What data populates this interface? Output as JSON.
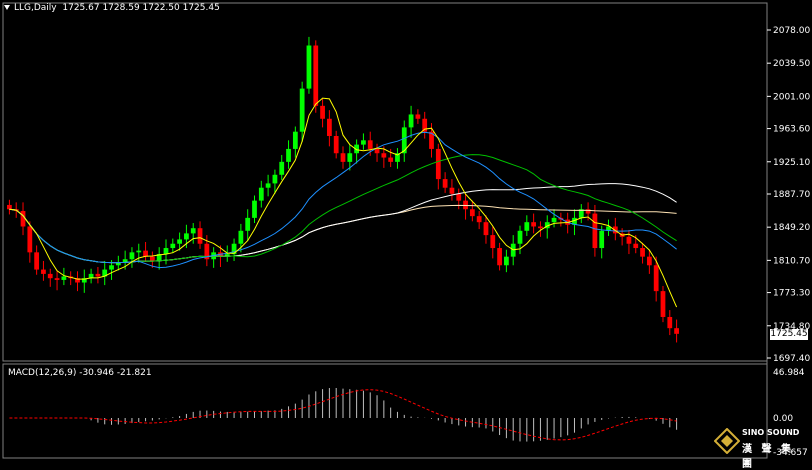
{
  "header": {
    "symbol_timeframe": "LLG,Daily",
    "ohlc": "1725.67 1728.59 1722.50 1725.45"
  },
  "price_axis": {
    "ticks": [
      "2078.00",
      "2039.50",
      "2001.00",
      "1963.60",
      "1925.10",
      "1887.70",
      "1849.20",
      "1810.70",
      "1773.30",
      "1734.80",
      "1697.40"
    ],
    "current_price": "1725.45"
  },
  "macd": {
    "label": "MACD(12,26,9) -30.946 -21.821",
    "ticks": [
      "46.984",
      "0.00",
      "-34.657"
    ]
  },
  "watermark": {
    "brand_en": "SINO SOUND",
    "brand_cn": "漢 聲 集 團"
  },
  "colors": {
    "bull": "#00ff00",
    "bear": "#ff0000",
    "ma_fast": "#ffff00",
    "ma_mid": "#1e90ff",
    "ma_slow": "#00c000",
    "ma_long": "#ffffff",
    "ma_longest": "#ffe4b5"
  },
  "chart_data": {
    "type": "candlestick",
    "ylim": [
      1697.4,
      2078.0
    ],
    "close_series": [
      1870,
      1868,
      1850,
      1820,
      1800,
      1795,
      1790,
      1788,
      1792,
      1790,
      1785,
      1790,
      1795,
      1792,
      1800,
      1805,
      1808,
      1812,
      1820,
      1822,
      1815,
      1810,
      1818,
      1825,
      1830,
      1835,
      1842,
      1848,
      1830,
      1812,
      1820,
      1815,
      1818,
      1830,
      1845,
      1860,
      1880,
      1895,
      1900,
      1910,
      1925,
      1940,
      1960,
      2010,
      2060,
      1990,
      1975,
      1955,
      1935,
      1925,
      1935,
      1945,
      1950,
      1940,
      1935,
      1930,
      1925,
      1935,
      1965,
      1980,
      1975,
      1960,
      1940,
      1905,
      1895,
      1888,
      1880,
      1870,
      1862,
      1855,
      1840,
      1825,
      1805,
      1815,
      1830,
      1845,
      1855,
      1850,
      1848,
      1855,
      1860,
      1858,
      1852,
      1860,
      1870,
      1865,
      1825,
      1845,
      1850,
      1842,
      1838,
      1830,
      1825,
      1815,
      1805,
      1775,
      1745,
      1732,
      1725.45
    ],
    "macd_hist_note": "histogram above zero mid-chart, below zero at right"
  }
}
